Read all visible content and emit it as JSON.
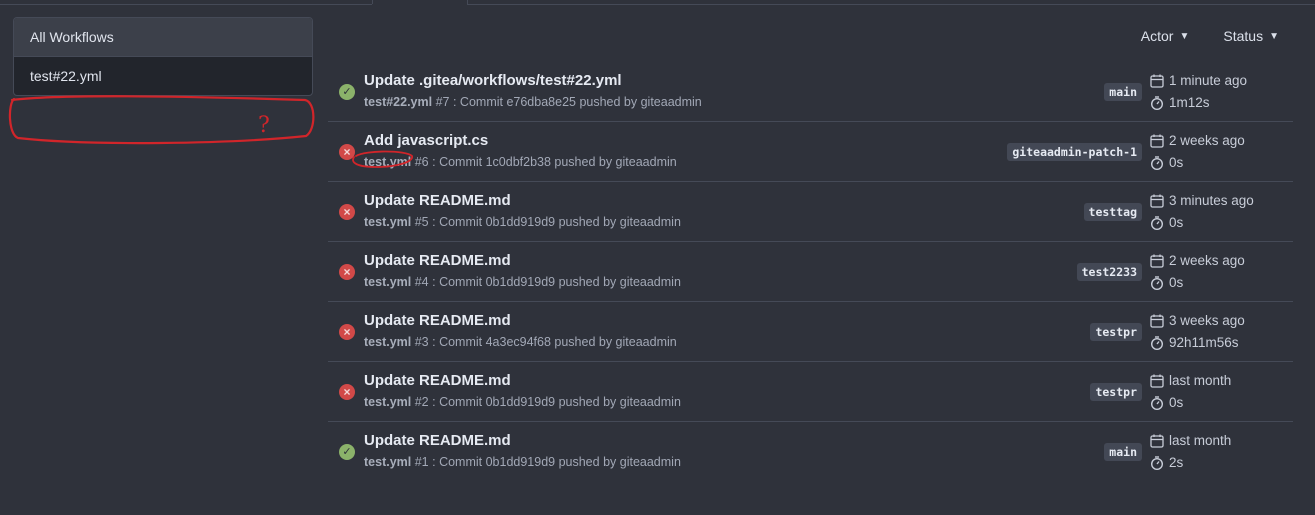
{
  "sidebar": {
    "items": [
      {
        "label": "All Workflows",
        "active": true
      },
      {
        "label": "test#22.yml",
        "active": false
      }
    ]
  },
  "filters": {
    "actor": "Actor",
    "status": "Status"
  },
  "annotation": {
    "mark": "?"
  },
  "runs": [
    {
      "title": "Update .gitea/workflows/test#22.yml",
      "workflow": "test#22.yml",
      "number": "#7",
      "commit_text": "Commit e76dba8e25 pushed by giteaadmin",
      "branch": "main",
      "time": "1 minute ago",
      "duration": "1m12s",
      "status": "success"
    },
    {
      "title": "Add javascript.cs",
      "workflow": "test.yml",
      "number": "#6",
      "commit_text": "Commit 1c0dbf2b38 pushed by giteaadmin",
      "branch": "giteaadmin-patch-1",
      "time": "2 weeks ago",
      "duration": "0s",
      "status": "failure"
    },
    {
      "title": "Update README.md",
      "workflow": "test.yml",
      "number": "#5",
      "commit_text": "Commit 0b1dd919d9 pushed by giteaadmin",
      "branch": "testtag",
      "time": "3 minutes ago",
      "duration": "0s",
      "status": "failure"
    },
    {
      "title": "Update README.md",
      "workflow": "test.yml",
      "number": "#4",
      "commit_text": "Commit 0b1dd919d9 pushed by giteaadmin",
      "branch": "test2233",
      "time": "2 weeks ago",
      "duration": "0s",
      "status": "failure"
    },
    {
      "title": "Update README.md",
      "workflow": "test.yml",
      "number": "#3",
      "commit_text": "Commit 4a3ec94f68 pushed by giteaadmin",
      "branch": "testpr",
      "time": "3 weeks ago",
      "duration": "92h11m56s",
      "status": "failure"
    },
    {
      "title": "Update README.md",
      "workflow": "test.yml",
      "number": "#2",
      "commit_text": "Commit 0b1dd919d9 pushed by giteaadmin",
      "branch": "testpr",
      "time": "last month",
      "duration": "0s",
      "status": "failure"
    },
    {
      "title": "Update README.md",
      "workflow": "test.yml",
      "number": "#1",
      "commit_text": "Commit 0b1dd919d9 pushed by giteaadmin",
      "branch": "main",
      "time": "last month",
      "duration": "2s",
      "status": "success"
    }
  ],
  "colors": {
    "success": "#8bb26a",
    "failure": "#d14948",
    "annotation": "#d1252a"
  }
}
